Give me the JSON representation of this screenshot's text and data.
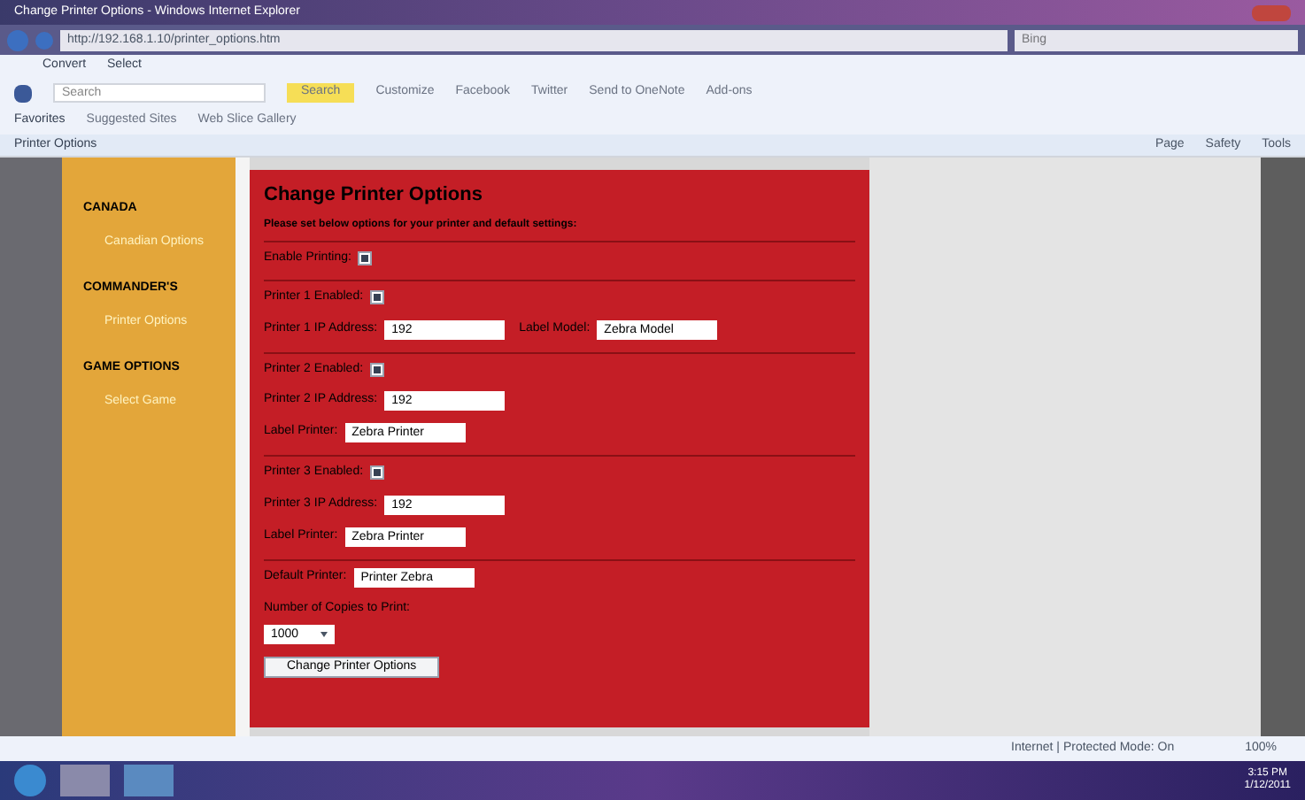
{
  "window": {
    "title": "Change Printer Options - Windows Internet Explorer"
  },
  "address_bar": {
    "value": "http://192.168.1.10/printer_options.htm"
  },
  "search_field": {
    "placeholder": "Bing"
  },
  "command_bar": [
    "Convert",
    "Select"
  ],
  "toolbar": {
    "search_placeholder": "Search",
    "items": [
      "Search",
      "Customize",
      "Facebook",
      "Twitter",
      "Send to OneNote",
      "Add-ons"
    ]
  },
  "favorites_bar": {
    "label": "Favorites",
    "links": [
      "Suggested Sites",
      "Web Slice Gallery"
    ]
  },
  "tab": {
    "label": "Printer Options"
  },
  "ie_commands": [
    "Page",
    "Safety",
    "Tools"
  ],
  "sidebar": [
    {
      "heading": "CANADA",
      "links": [
        "Canadian Options"
      ]
    },
    {
      "heading": "COMMANDER'S",
      "links": [
        "Printer Options"
      ]
    },
    {
      "heading": "GAME OPTIONS",
      "links": [
        "Select Game"
      ]
    }
  ],
  "panel": {
    "title": "Change Printer Options",
    "intro": "Please set below options for your printer and default settings:",
    "groups": [
      {
        "rows": [
          {
            "kind": "checkbox",
            "label": "Enable Printing:",
            "checked": true
          }
        ]
      },
      {
        "rows": [
          {
            "kind": "checkbox",
            "label": "Printer 1 Enabled:",
            "checked": true
          },
          {
            "kind": "pair",
            "label": "Printer 1 IP Address:",
            "value": "192",
            "label2": "Label Model:",
            "value2": "Zebra Model"
          }
        ]
      },
      {
        "rows": [
          {
            "kind": "checkbox",
            "label": "Printer 2 Enabled:",
            "checked": true
          },
          {
            "kind": "field",
            "label": "Printer 2 IP Address:",
            "value": "192"
          },
          {
            "kind": "field",
            "label": "Label Printer:",
            "value": "Zebra Printer"
          }
        ]
      },
      {
        "rows": [
          {
            "kind": "checkbox",
            "label": "Printer 3 Enabled:",
            "checked": true
          },
          {
            "kind": "field",
            "label": "Printer 3 IP Address:",
            "value": "192"
          },
          {
            "kind": "field",
            "label": "Label Printer:",
            "value": "Zebra Printer"
          }
        ]
      },
      {
        "rows": [
          {
            "kind": "field",
            "label": "Default Printer:",
            "value": "Printer Zebra"
          },
          {
            "kind": "select",
            "label": "Number of Copies to Print:",
            "value": "1000"
          },
          {
            "kind": "button",
            "label": "Change Printer Options"
          }
        ]
      }
    ]
  },
  "status_bar": {
    "zone": "Internet | Protected Mode: On",
    "zoom": "100%"
  },
  "taskbar": {
    "time": "3:15 PM",
    "date": "1/12/2011"
  }
}
